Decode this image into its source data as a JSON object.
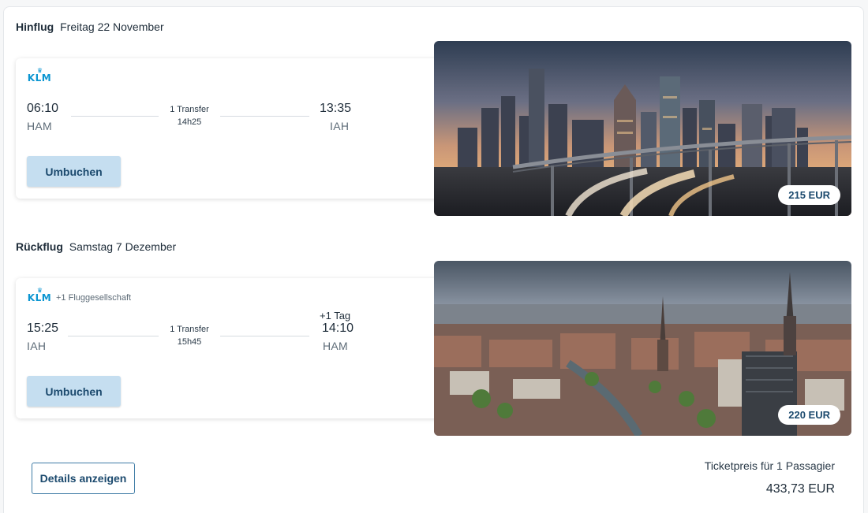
{
  "outbound": {
    "label": "Hinflug",
    "date": "Freitag 22 November",
    "airline_logo": "KLM",
    "airline_extra": "",
    "depart_time": "06:10",
    "depart_code": "HAM",
    "arrive_time": "13:35",
    "arrive_code": "IAH",
    "transfers": "1 Transfer",
    "duration": "14h25",
    "plus_day": "",
    "rebook_label": "Umbuchen",
    "price": "215 EUR",
    "image": "houston-skyline-photo"
  },
  "return": {
    "label": "Rückflug",
    "date": "Samstag 7 Dezember",
    "airline_logo": "KLM",
    "airline_extra": "+1 Fluggesellschaft",
    "depart_time": "15:25",
    "depart_code": "IAH",
    "arrive_time": "14:10",
    "arrive_code": "HAM",
    "transfers": "1 Transfer",
    "duration": "15h45",
    "plus_day": "+1 Tag",
    "rebook_label": "Umbuchen",
    "price": "220 EUR",
    "image": "hamburg-city-photo"
  },
  "footer": {
    "details_label": "Details anzeigen",
    "ticket_label": "Ticketpreis für 1 Passagier",
    "ticket_total": "433,73 EUR"
  },
  "colors": {
    "accent": "#1c4a6e",
    "button_bg": "#c5def0",
    "klm_blue": "#0a95d1"
  }
}
